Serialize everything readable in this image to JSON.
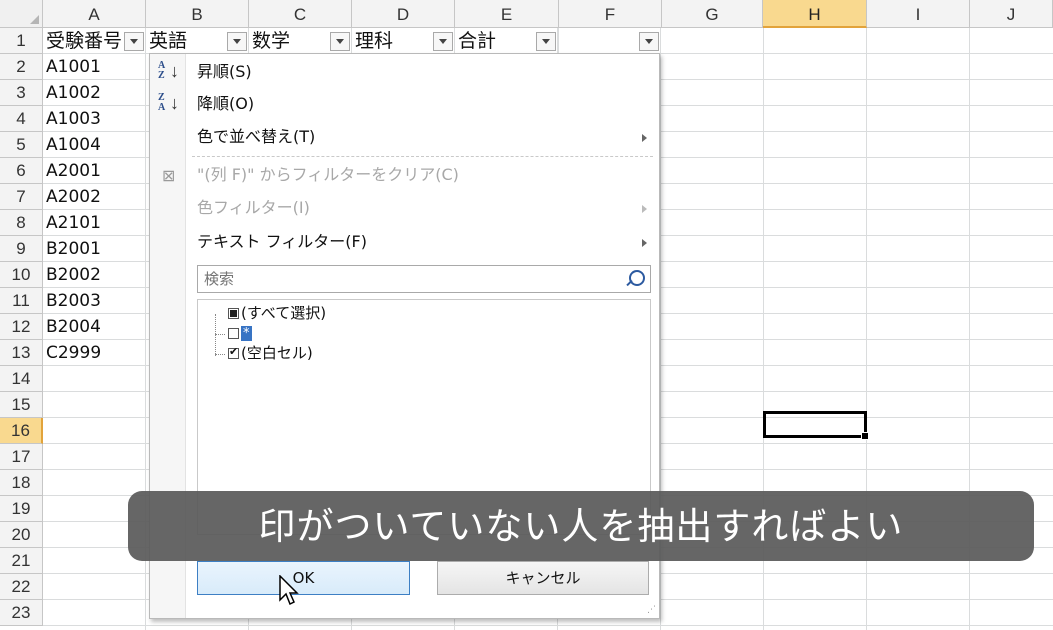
{
  "columns": [
    "A",
    "B",
    "C",
    "D",
    "E",
    "F",
    "G",
    "H",
    "I",
    "J"
  ],
  "rows": [
    "1",
    "2",
    "3",
    "4",
    "5",
    "6",
    "7",
    "8",
    "9",
    "10",
    "11",
    "12",
    "13",
    "14",
    "15",
    "16",
    "17",
    "18",
    "19",
    "20",
    "21",
    "22",
    "23"
  ],
  "header_row": {
    "a": "受験番号",
    "b": "英語",
    "c": "数学",
    "d": "理科",
    "e": "合計"
  },
  "exam_ids": [
    "A1001",
    "A1002",
    "A1003",
    "A1004",
    "A2001",
    "A2002",
    "A2101",
    "B2001",
    "B2002",
    "B2003",
    "B2004",
    "C2999"
  ],
  "filter_menu": {
    "sort_asc": "昇順(S)",
    "sort_desc": "降順(O)",
    "sort_by_color": "色で並べ替え(T)",
    "clear_filter": "\"(列 F)\" からフィルターをクリア(C)",
    "color_filter": "色フィルター(I)",
    "text_filter": "テキスト フィルター(F)",
    "search_placeholder": "検索",
    "items": [
      {
        "label": "(すべて選択)",
        "state": "partial"
      },
      {
        "label": "*",
        "state": "unchecked"
      },
      {
        "label": "(空白セル)",
        "state": "checked"
      }
    ],
    "ok_label": "OK",
    "cancel_label": "キャンセル"
  },
  "caption": "印がついていない人を抽出すればよい",
  "colors": {
    "accent": "#3874c4",
    "selected_header": "#f9d98f",
    "caption_bg": "#5a5a5a"
  },
  "active_cell": "H16"
}
